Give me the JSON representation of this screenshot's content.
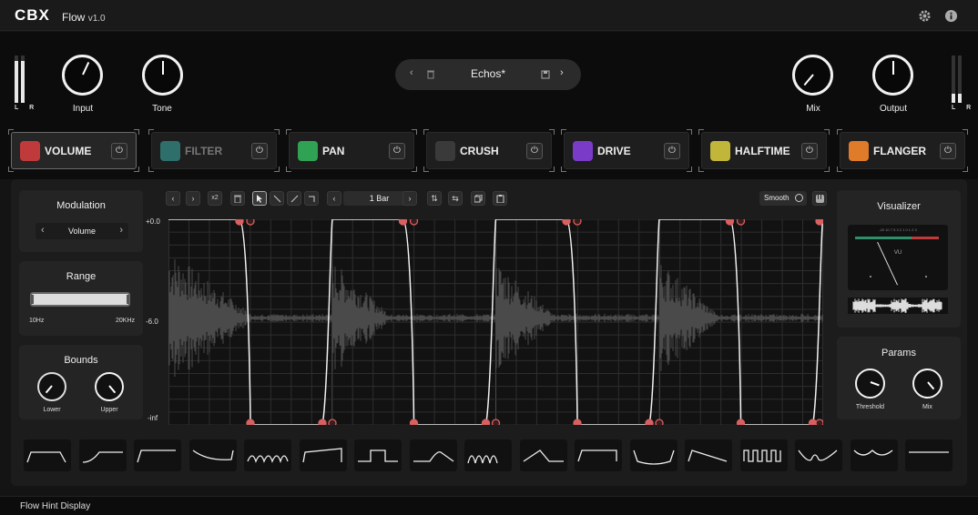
{
  "header": {
    "logo": "CBX",
    "app_name": "Flow",
    "version": "v1.0",
    "icons": [
      "gear-icon",
      "info-icon"
    ]
  },
  "io": {
    "meter_lr_label": "L R",
    "input_meter_levels": [
      0.88,
      0.88
    ],
    "output_meter_levels": [
      0.2,
      0.2
    ],
    "knobs": [
      {
        "label": "Input"
      },
      {
        "label": "Tone"
      },
      {
        "label": "Mix"
      },
      {
        "label": "Output"
      }
    ]
  },
  "preset": {
    "name": "Echos*"
  },
  "effects": [
    {
      "label": "VOLUME",
      "color": "#c0393b",
      "enabled": true,
      "selected": true
    },
    {
      "label": "FILTER",
      "color": "#2f6f6b",
      "enabled": false,
      "selected": false
    },
    {
      "label": "PAN",
      "color": "#2fa253",
      "enabled": true,
      "selected": false
    },
    {
      "label": "CRUSH",
      "color": "#3a3a3a",
      "enabled": true,
      "selected": false
    },
    {
      "label": "DRIVE",
      "color": "#7b3bc9",
      "enabled": true,
      "selected": false
    },
    {
      "label": "HALFTIME",
      "color": "#c2b63a",
      "enabled": true,
      "selected": false
    },
    {
      "label": "FLANGER",
      "color": "#e07b2a",
      "enabled": true,
      "selected": false
    }
  ],
  "modulation": {
    "title": "Modulation",
    "target": "Volume"
  },
  "range": {
    "title": "Range",
    "min_label": "10Hz",
    "max_label": "20KHz"
  },
  "bounds": {
    "title": "Bounds",
    "lower_label": "Lower",
    "upper_label": "Upper"
  },
  "toolbar": {
    "multiplier": "x2",
    "length": "1 Bar",
    "smooth_label": "Smooth"
  },
  "editor": {
    "y_labels": [
      "+0.0",
      "-6.0",
      "-inf"
    ]
  },
  "visualizer": {
    "title": "Visualizer",
    "vu_label": "VU",
    "vu_scale": "-20 10 7 5 3 2 1 0 1 2 3"
  },
  "params": {
    "title": "Params",
    "threshold_label": "Threshold",
    "mix_label": "Mix"
  },
  "shapes": [
    "shape-1",
    "shape-2",
    "shape-3",
    "shape-4",
    "shape-5",
    "shape-6",
    "shape-7",
    "shape-8",
    "shape-9",
    "shape-10",
    "shape-11",
    "shape-12",
    "shape-13",
    "shape-14",
    "shape-15",
    "shape-16",
    "shape-17"
  ],
  "status": {
    "hint": "Flow Hint Display"
  }
}
